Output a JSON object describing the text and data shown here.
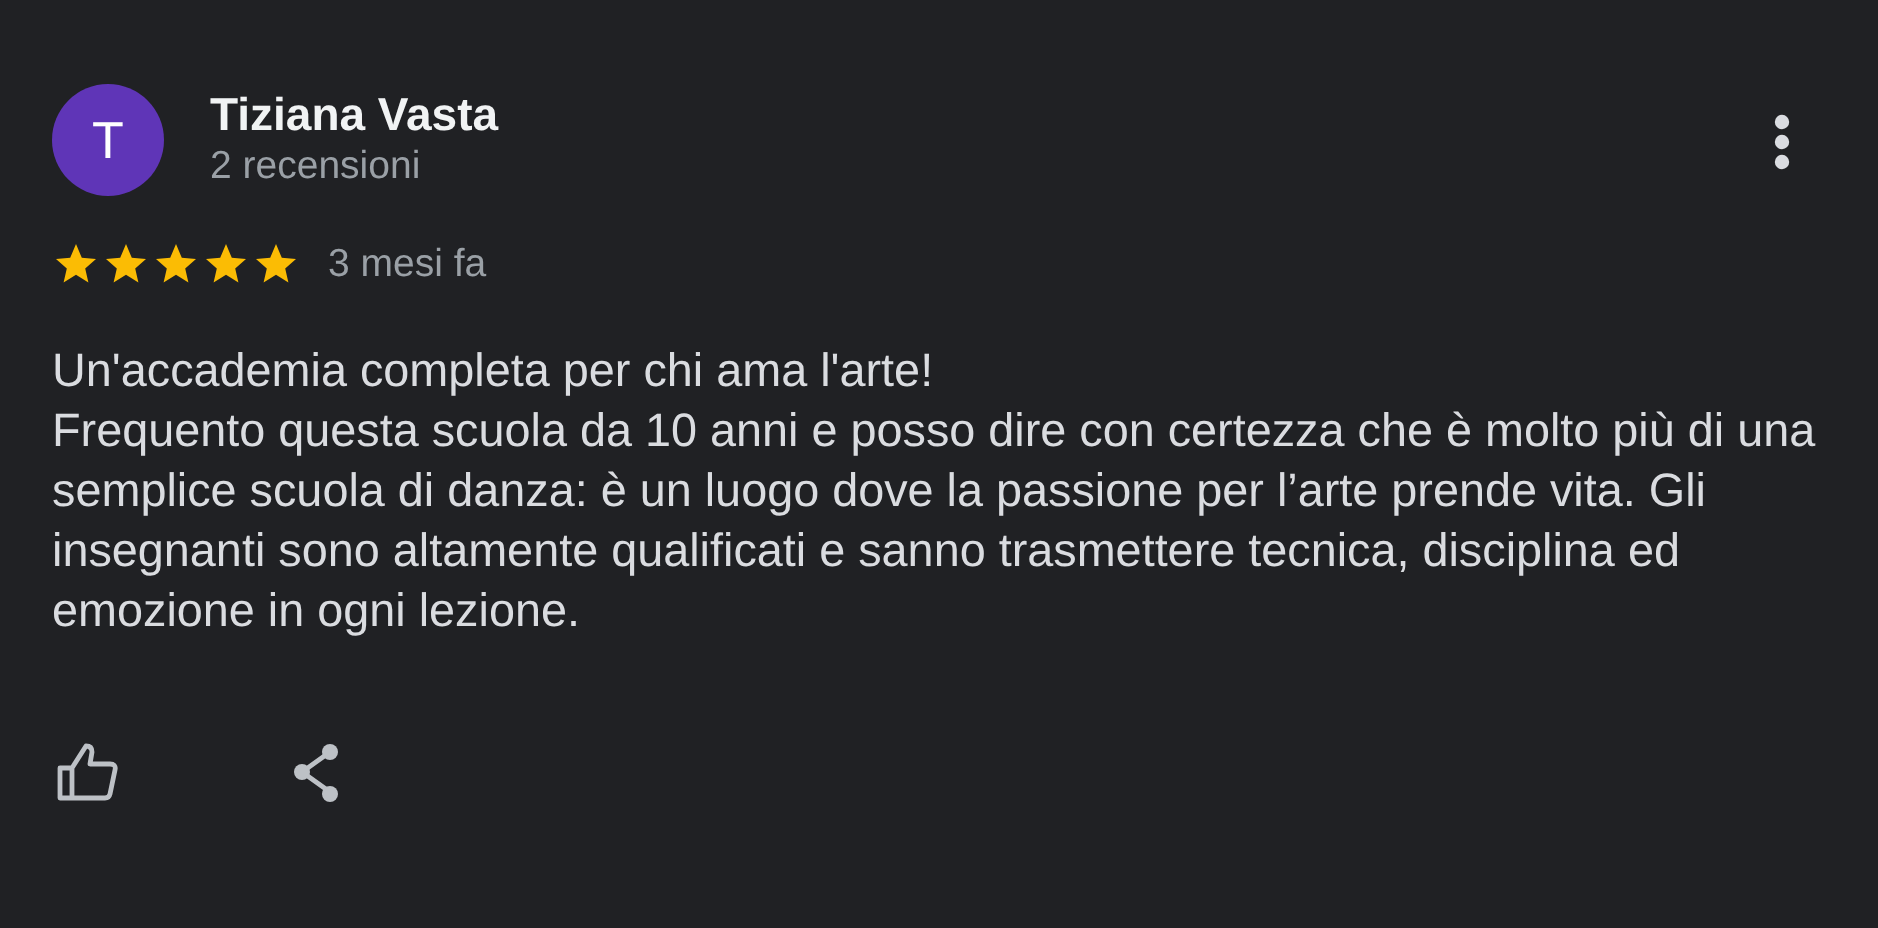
{
  "review": {
    "avatar_letter": "T",
    "author": "Tiziana Vasta",
    "review_count": "2 recensioni",
    "stars": 5,
    "time": "3 mesi fa",
    "paragraphs": [
      "Un'accademia completa per chi ama l'arte!",
      "Frequento questa scuola da 10 anni e posso dire con certezza che è molto più di una semplice scuola di danza: è un luogo dove la passione per l’arte prende vita. Gli insegnanti sono altamente qualificati e sanno trasmettere tecnica, disciplina ed emozione in ogni lezione."
    ]
  }
}
